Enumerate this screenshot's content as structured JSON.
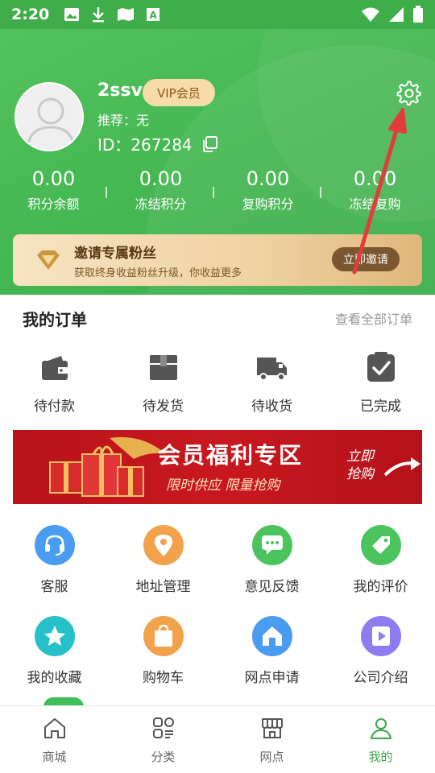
{
  "status_bar": {
    "time": "2:20"
  },
  "profile": {
    "username": "2ssv",
    "vip_label": "VIP会员",
    "referrer": "推荐：无",
    "id_label": "ID：267284"
  },
  "stats": [
    {
      "value": "0.00",
      "label": "积分余额"
    },
    {
      "value": "0.00",
      "label": "冻结积分"
    },
    {
      "value": "0.00",
      "label": "复购积分"
    },
    {
      "value": "0.00",
      "label": "冻结复购"
    }
  ],
  "invite": {
    "title": "邀请专属粉丝",
    "subtitle": "获取终身收益粉丝升级，你收益更多",
    "button": "立即邀请"
  },
  "orders": {
    "title": "我的订单",
    "view_all": "查看全部订单",
    "items": [
      {
        "label": "待付款",
        "icon": "wallet-icon"
      },
      {
        "label": "待发货",
        "icon": "package-icon"
      },
      {
        "label": "待收货",
        "icon": "truck-icon"
      },
      {
        "label": "已完成",
        "icon": "check-clipboard-icon"
      }
    ]
  },
  "banner": {
    "title": "会员福利专区",
    "subtitle": "限时供应 限量抢购",
    "cta_line1": "立即",
    "cta_line2": "抢购"
  },
  "services": [
    {
      "label": "客服",
      "icon": "headset-icon",
      "color": "#4a9cf0"
    },
    {
      "label": "地址管理",
      "icon": "location-icon",
      "color": "#f2a24a"
    },
    {
      "label": "意见反馈",
      "icon": "chat-icon",
      "color": "#4cc45e"
    },
    {
      "label": "我的评价",
      "icon": "tag-icon",
      "color": "#4cc45e"
    },
    {
      "label": "我的收藏",
      "icon": "star-icon",
      "color": "#26c0c8"
    },
    {
      "label": "购物车",
      "icon": "shopping-bag-icon",
      "color": "#f2a24a"
    },
    {
      "label": "网点申请",
      "icon": "home-icon",
      "color": "#4a9cf0"
    },
    {
      "label": "公司介绍",
      "icon": "play-icon",
      "color": "#8c7cf0"
    }
  ],
  "tabs": [
    {
      "label": "商城",
      "icon": "store-icon",
      "active": false
    },
    {
      "label": "分类",
      "icon": "category-icon",
      "active": false
    },
    {
      "label": "网点",
      "icon": "shop-icon",
      "active": false
    },
    {
      "label": "我的",
      "icon": "person-icon",
      "active": true
    }
  ],
  "colors": {
    "primary_green": "#45b752",
    "active_tab": "#3aa748",
    "banner_red": "#c8181f"
  }
}
